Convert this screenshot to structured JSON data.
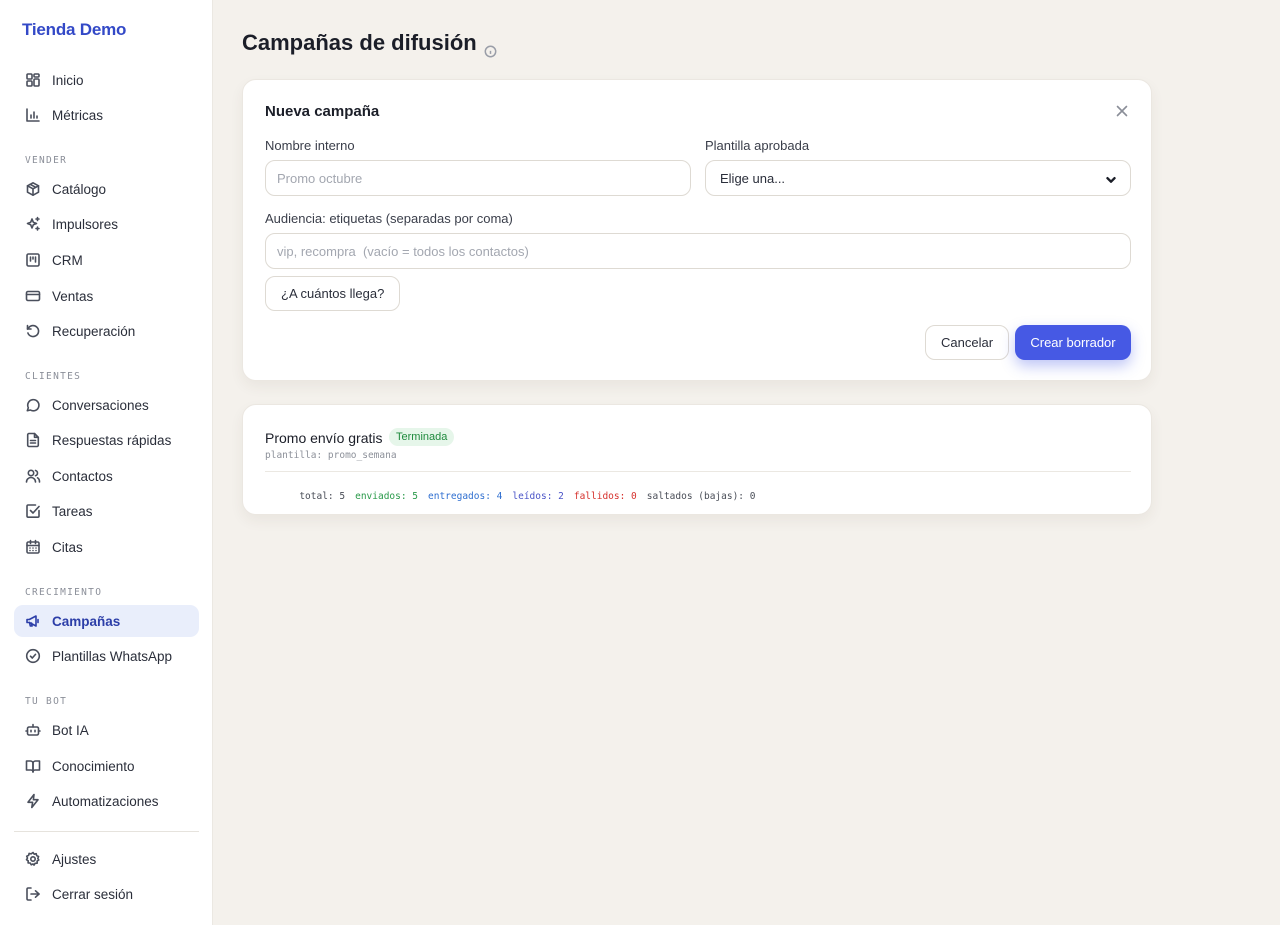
{
  "sidebar": {
    "brand": "Tienda Demo",
    "sections": {
      "vender": "VENDER",
      "clientes": "CLIENTES",
      "crecimiento": "CRECIMIENTO",
      "tubot": "TU BOT"
    },
    "items": [
      {
        "label": "Inicio",
        "icon": "grid-icon"
      },
      {
        "label": "Métricas",
        "icon": "bar-chart-icon"
      },
      {
        "label": "Catálogo",
        "icon": "box-icon"
      },
      {
        "label": "Impulsores",
        "icon": "sparkles-icon"
      },
      {
        "label": "CRM",
        "icon": "kanban-icon"
      },
      {
        "label": "Ventas",
        "icon": "credit-card-icon"
      },
      {
        "label": "Recuperación",
        "icon": "rotate-ccw-icon"
      },
      {
        "label": "Conversaciones",
        "icon": "message-circle-icon"
      },
      {
        "label": "Respuestas rápidas",
        "icon": "file-text-icon"
      },
      {
        "label": "Contactos",
        "icon": "users-icon"
      },
      {
        "label": "Tareas",
        "icon": "check-square-icon"
      },
      {
        "label": "Citas",
        "icon": "calendar-icon"
      },
      {
        "label": "Campañas",
        "icon": "megaphone-icon",
        "active": true
      },
      {
        "label": "Plantillas WhatsApp",
        "icon": "check-circle-icon"
      },
      {
        "label": "Bot IA",
        "icon": "bot-icon"
      },
      {
        "label": "Conocimiento",
        "icon": "book-open-icon"
      },
      {
        "label": "Automatizaciones",
        "icon": "zap-icon"
      },
      {
        "label": "Ajustes",
        "icon": "gear-icon"
      },
      {
        "label": "Cerrar sesión",
        "icon": "log-out-icon"
      }
    ]
  },
  "page": {
    "title": "Campañas de difusión"
  },
  "new_campaign": {
    "title": "Nueva campaña",
    "name_label": "Nombre interno",
    "name_placeholder": "Promo octubre",
    "name_value": "",
    "template_label": "Plantilla aprobada",
    "template_selected": "Elige una...",
    "audience_label": "Audiencia: etiquetas (separadas por coma)",
    "audience_placeholder": "vip, recompra  (vacío = todos los contactos)",
    "audience_value": "",
    "reach_button": "¿A cuántos llega?",
    "cancel_button": "Cancelar",
    "create_button": "Crear borrador"
  },
  "campaigns": [
    {
      "name": "Promo envío gratis",
      "status": "Terminada",
      "template": "plantilla: promo_semana",
      "stats": {
        "total": "total: 5",
        "enviados": "enviados: 5",
        "entregados": "entregados: 4",
        "leidos": "leídos: 2",
        "fallidos": "fallidos: 0",
        "saltados": "saltados (bajas): 0"
      }
    }
  ],
  "colors": {
    "accent": "#4659e4",
    "brand": "#3349c7",
    "background": "#f4f1ec",
    "status_done": "#1f8a3d"
  }
}
